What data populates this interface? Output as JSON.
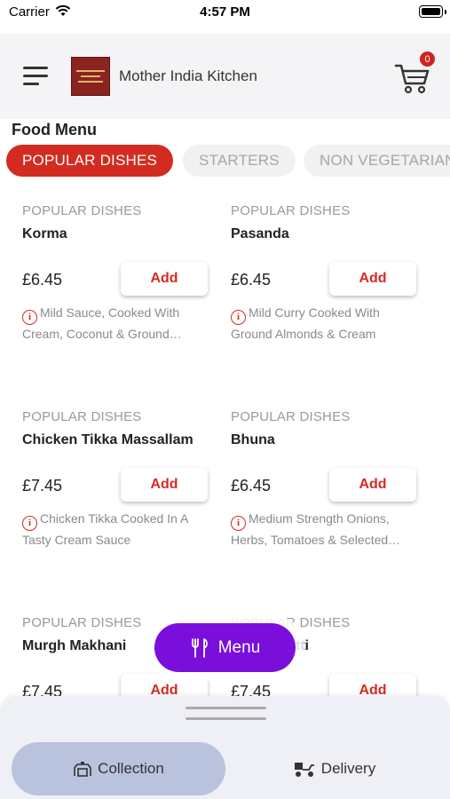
{
  "status_bar": {
    "carrier": "Carrier",
    "time": "4:57 PM"
  },
  "header": {
    "restaurant_name": "Mother India Kitchen",
    "cart_count": "0"
  },
  "menu": {
    "title": "Food Menu",
    "tabs": [
      {
        "label": "POPULAR DISHES",
        "active": true
      },
      {
        "label": "STARTERS",
        "active": false
      },
      {
        "label": "NON VEGETARIAN",
        "active": false
      }
    ],
    "items": [
      {
        "category": "POPULAR DISHES",
        "name": "Korma",
        "price": "£6.45",
        "add_label": "Add",
        "description": "Mild Sauce, Cooked With Cream, Coconut & Ground…"
      },
      {
        "category": "POPULAR DISHES",
        "name": "Pasanda",
        "price": "£6.45",
        "add_label": "Add",
        "description": "Mild Curry Cooked With Ground Almonds & Cream"
      },
      {
        "category": "POPULAR DISHES",
        "name": "Chicken Tikka Massallam",
        "price": "£7.45",
        "add_label": "Add",
        "description": "Chicken Tikka Cooked In A Tasty Cream Sauce"
      },
      {
        "category": "POPULAR DISHES",
        "name": "Bhuna",
        "price": "£6.45",
        "add_label": "Add",
        "description": "Medium Strength Onions, Herbs, Tomatoes & Selected…"
      },
      {
        "category": "POPULAR DISHES",
        "name": "Murgh Makhani",
        "price": "£7.45",
        "add_label": "Add",
        "description": ""
      },
      {
        "category": "POPULAR DISHES",
        "name": "Bhuna cutti",
        "price": "£7.45",
        "add_label": "Add",
        "description": ""
      }
    ]
  },
  "fab": {
    "label": "Menu"
  },
  "order_type": {
    "options": [
      {
        "label": "Collection",
        "active": true
      },
      {
        "label": "Delivery",
        "active": false
      }
    ]
  },
  "colors": {
    "accent_red": "#d42b20",
    "fab_purple": "#7a0fdc",
    "selected_segment": "#b9c3dd"
  },
  "icons": [
    "wifi-icon",
    "battery-icon",
    "hamburger-icon",
    "cart-icon",
    "info-icon",
    "fork-knife-icon",
    "collection-icon",
    "delivery-scooter-icon"
  ]
}
